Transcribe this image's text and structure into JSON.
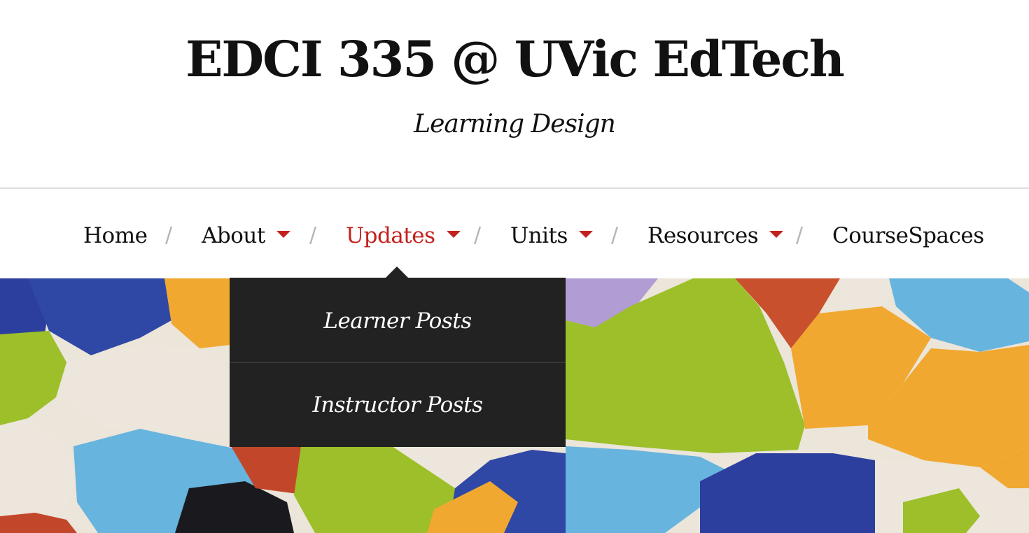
{
  "site": {
    "title": "EDCI 335 @ UVic EdTech",
    "tagline": "Learning Design"
  },
  "nav": {
    "separator": "/",
    "items": [
      {
        "label": "Home",
        "has_submenu": false,
        "active": false
      },
      {
        "label": "About",
        "has_submenu": true,
        "active": false
      },
      {
        "label": "Updates",
        "has_submenu": true,
        "active": true
      },
      {
        "label": "Units",
        "has_submenu": true,
        "active": false
      },
      {
        "label": "Resources",
        "has_submenu": true,
        "active": false
      },
      {
        "label": "CourseSpaces",
        "has_submenu": false,
        "active": false
      }
    ],
    "submenu_caret": "caret-down-icon"
  },
  "dropdown": {
    "parent": "Updates",
    "items": [
      {
        "label": "Learner Posts"
      },
      {
        "label": "Instructor Posts"
      }
    ]
  },
  "colors": {
    "accent": "#c3211d",
    "text": "#111111",
    "separator": "#b5b5b5",
    "dropdown_bg": "#222222",
    "dropdown_text": "#ffffff"
  },
  "hero": {
    "image": "colorful-painted-stones-mosaic"
  }
}
